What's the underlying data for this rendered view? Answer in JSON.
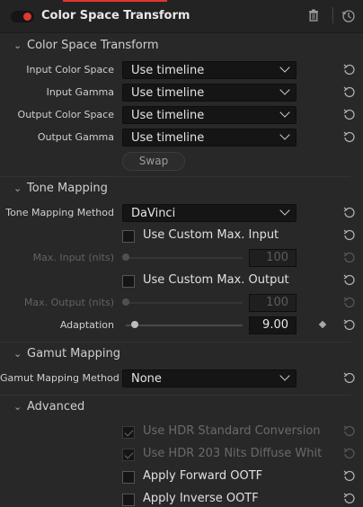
{
  "header": {
    "title": "Color Space Transform",
    "icons": [
      "trash-icon",
      "history-icon"
    ],
    "enabled": true
  },
  "sections": {
    "cst": {
      "title": "Color Space Transform",
      "input_color_space": {
        "label": "Input Color Space",
        "value": "Use timeline"
      },
      "input_gamma": {
        "label": "Input Gamma",
        "value": "Use timeline"
      },
      "output_color_space": {
        "label": "Output Color Space",
        "value": "Use timeline"
      },
      "output_gamma": {
        "label": "Output Gamma",
        "value": "Use timeline"
      },
      "swap_label": "Swap"
    },
    "tone": {
      "title": "Tone Mapping",
      "method": {
        "label": "Tone Mapping Method",
        "value": "DaVinci"
      },
      "custom_max_input": {
        "label": "Use Custom Max. Input",
        "checked": false
      },
      "max_input": {
        "label": "Max. Input (nits)",
        "value": "100",
        "enabled": false
      },
      "custom_max_output": {
        "label": "Use Custom Max. Output",
        "checked": false
      },
      "max_output": {
        "label": "Max. Output (nits)",
        "value": "100",
        "enabled": false
      },
      "adaptation": {
        "label": "Adaptation",
        "value": "9.00"
      }
    },
    "gamut": {
      "title": "Gamut Mapping",
      "method": {
        "label": "Gamut Mapping Method",
        "value": "None"
      }
    },
    "advanced": {
      "title": "Advanced",
      "hdr_standard": {
        "label": "Use HDR Standard Conversion",
        "checked": true,
        "enabled": false
      },
      "hdr_203": {
        "label": "Use HDR 203 Nits Diffuse Whit",
        "checked": true,
        "enabled": false
      },
      "forward_ootf": {
        "label": "Apply Forward OOTF",
        "checked": false
      },
      "inverse_ootf": {
        "label": "Apply Inverse OOTF",
        "checked": false
      }
    }
  },
  "colors": {
    "accent": "#e0382f",
    "panel": "#282828",
    "field": "#151515"
  }
}
